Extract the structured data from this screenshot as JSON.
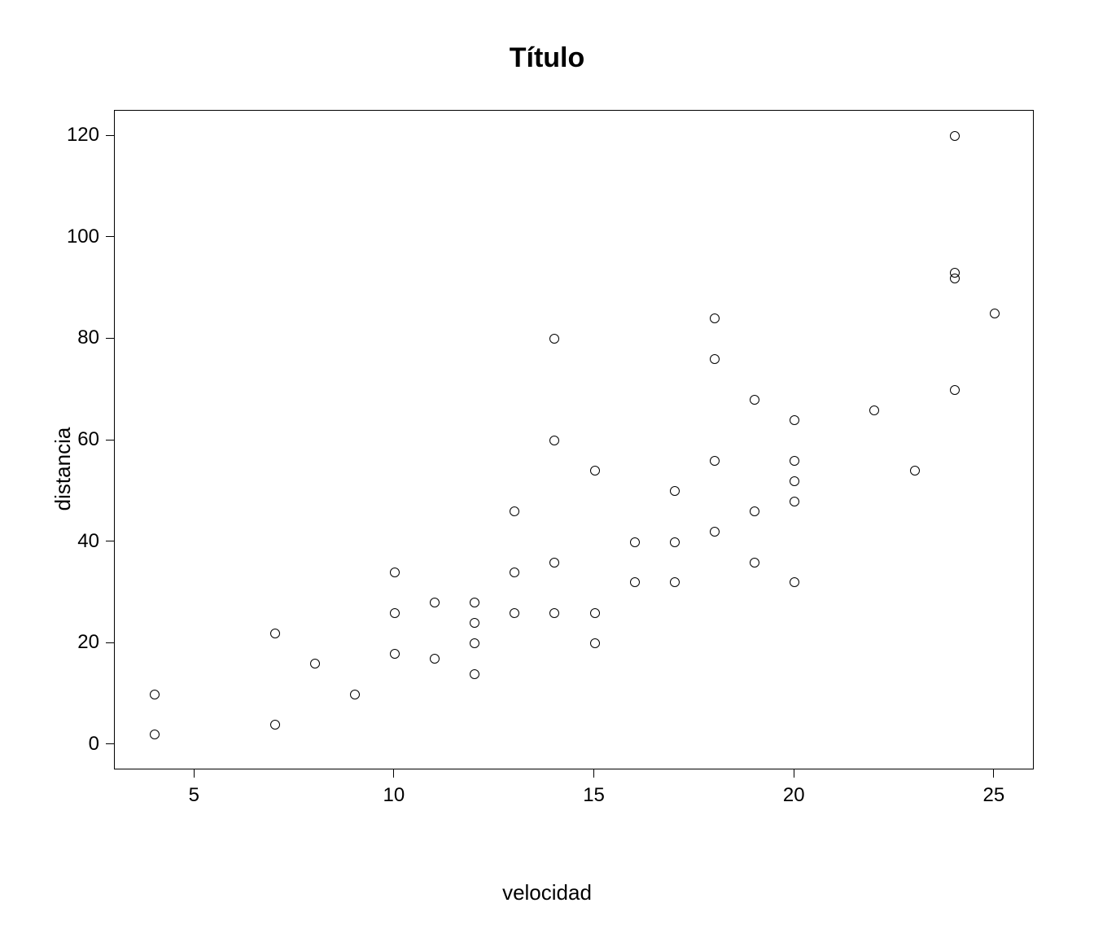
{
  "chart_data": {
    "type": "scatter",
    "title": "Título",
    "xlabel": "velocidad",
    "ylabel": "distancia",
    "xlim": [
      3,
      26
    ],
    "ylim": [
      -5,
      125
    ],
    "xticks": [
      5,
      10,
      15,
      20,
      25
    ],
    "yticks": [
      0,
      20,
      40,
      60,
      80,
      100,
      120
    ],
    "points": [
      {
        "x": 4,
        "y": 2
      },
      {
        "x": 4,
        "y": 10
      },
      {
        "x": 7,
        "y": 4
      },
      {
        "x": 7,
        "y": 22
      },
      {
        "x": 8,
        "y": 16
      },
      {
        "x": 9,
        "y": 10
      },
      {
        "x": 10,
        "y": 18
      },
      {
        "x": 10,
        "y": 26
      },
      {
        "x": 10,
        "y": 34
      },
      {
        "x": 11,
        "y": 17
      },
      {
        "x": 11,
        "y": 28
      },
      {
        "x": 12,
        "y": 14
      },
      {
        "x": 12,
        "y": 20
      },
      {
        "x": 12,
        "y": 24
      },
      {
        "x": 12,
        "y": 28
      },
      {
        "x": 13,
        "y": 26
      },
      {
        "x": 13,
        "y": 34
      },
      {
        "x": 13,
        "y": 46
      },
      {
        "x": 14,
        "y": 26
      },
      {
        "x": 14,
        "y": 36
      },
      {
        "x": 14,
        "y": 60
      },
      {
        "x": 14,
        "y": 80
      },
      {
        "x": 15,
        "y": 20
      },
      {
        "x": 15,
        "y": 26
      },
      {
        "x": 15,
        "y": 54
      },
      {
        "x": 16,
        "y": 32
      },
      {
        "x": 16,
        "y": 40
      },
      {
        "x": 17,
        "y": 32
      },
      {
        "x": 17,
        "y": 40
      },
      {
        "x": 17,
        "y": 50
      },
      {
        "x": 18,
        "y": 42
      },
      {
        "x": 18,
        "y": 56
      },
      {
        "x": 18,
        "y": 76
      },
      {
        "x": 18,
        "y": 84
      },
      {
        "x": 19,
        "y": 36
      },
      {
        "x": 19,
        "y": 46
      },
      {
        "x": 19,
        "y": 68
      },
      {
        "x": 20,
        "y": 32
      },
      {
        "x": 20,
        "y": 48
      },
      {
        "x": 20,
        "y": 52
      },
      {
        "x": 20,
        "y": 56
      },
      {
        "x": 20,
        "y": 64
      },
      {
        "x": 22,
        "y": 66
      },
      {
        "x": 23,
        "y": 54
      },
      {
        "x": 24,
        "y": 70
      },
      {
        "x": 24,
        "y": 92
      },
      {
        "x": 24,
        "y": 93
      },
      {
        "x": 24,
        "y": 120
      },
      {
        "x": 25,
        "y": 85
      }
    ]
  }
}
